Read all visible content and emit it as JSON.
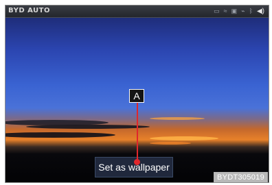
{
  "status_bar": {
    "brand": "BYD AUTO",
    "icons": [
      "screen-icon",
      "wifi-icon",
      "sd-card-icon",
      "usb-icon",
      "bluetooth-icon",
      "volume-icon"
    ]
  },
  "wallpaper": {
    "description_colors": {
      "sky_top": "#1b2a7a",
      "sky_mid": "#3557c8",
      "horizon": "#e8702a",
      "ground": "#05060a"
    }
  },
  "action": {
    "set_wallpaper_label": "Set as wallpaper"
  },
  "callout": {
    "label": "A",
    "color": "#e0262b"
  },
  "reference_code": "BYDT305019"
}
